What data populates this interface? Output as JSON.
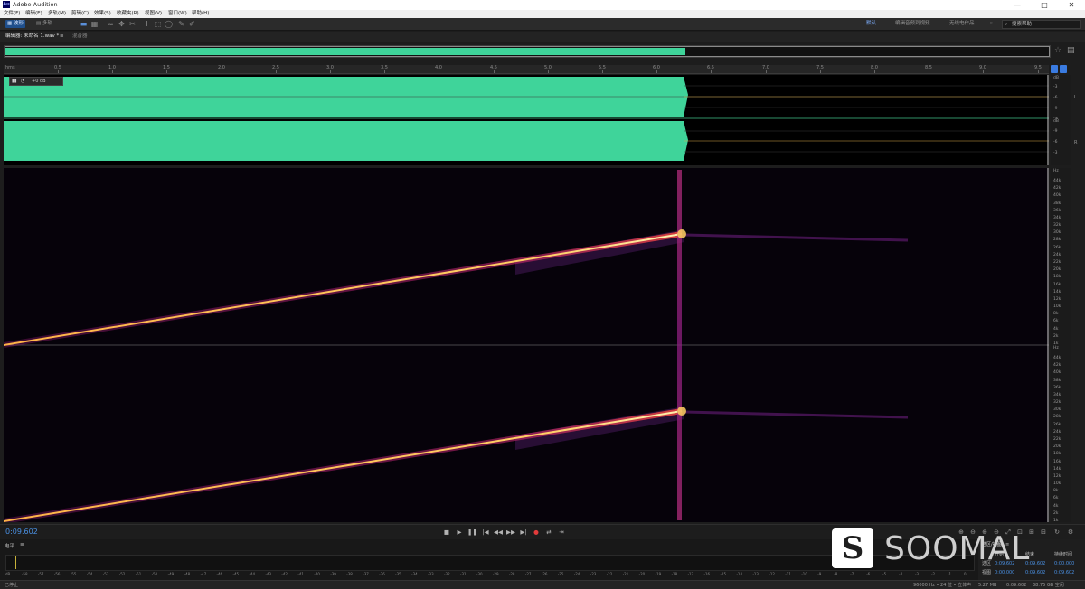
{
  "app": {
    "title": "Adobe Audition",
    "icon_text": "Au"
  },
  "window_controls": {
    "minimize": "—",
    "maximize": "□",
    "close": "✕"
  },
  "menu": [
    "文件(F)",
    "编辑(E)",
    "多轨(M)",
    "剪辑(C)",
    "效果(S)",
    "收藏夹(R)",
    "视图(V)",
    "窗口(W)",
    "帮助(H)"
  ],
  "toolbar": {
    "mode_waveform": "波形",
    "mode_multitrack": "多轨",
    "workspace_default": "默认",
    "workspace_edit_audio_video": "编辑音频到视频",
    "workspace_radio": "无线电作品",
    "overflow": "»",
    "search_placeholder": "搜索帮助"
  },
  "tabs": {
    "editor": "编辑器: 未命名 1.wav *",
    "editor_menu": "≡",
    "mixer": "混音器"
  },
  "ruler": {
    "unit": "hms",
    "labels": [
      "0.5",
      "1.0",
      "1.5",
      "2.0",
      "2.5",
      "3.0",
      "3.5",
      "4.0",
      "4.5",
      "5.0",
      "5.5",
      "6.0",
      "6.5",
      "7.0",
      "7.5",
      "8.0",
      "8.5",
      "9.0",
      "9.5"
    ]
  },
  "hud": {
    "volume": "+0 dB"
  },
  "waveform_scale": {
    "unit": "dB",
    "labels": [
      "-3",
      "-6",
      "-9",
      "-∞",
      "-9",
      "-6",
      "-3"
    ],
    "channel_labels": [
      "L",
      "R"
    ]
  },
  "spectral_scale": {
    "unit": "Hz",
    "labels": [
      "44k",
      "42k",
      "40k",
      "38k",
      "36k",
      "34k",
      "32k",
      "30k",
      "28k",
      "26k",
      "24k",
      "22k",
      "20k",
      "18k",
      "16k",
      "14k",
      "12k",
      "10k",
      "8k",
      "6k",
      "4k",
      "2k",
      "1k"
    ]
  },
  "transport": {
    "current_time": "0:09.602",
    "buttons": [
      "■",
      "▶",
      "❚❚",
      "|◀",
      "◀◀",
      "▶▶",
      "▶|",
      "●",
      "⇄",
      "⇥"
    ]
  },
  "levels": {
    "header": "电平",
    "menu": "≡",
    "scale": [
      "dB",
      "-58",
      "-57",
      "-56",
      "-55",
      "-54",
      "-53",
      "-52",
      "-51",
      "-50",
      "-49",
      "-48",
      "-47",
      "-46",
      "-45",
      "-44",
      "-43",
      "-42",
      "-41",
      "-40",
      "-39",
      "-38",
      "-37",
      "-36",
      "-35",
      "-34",
      "-33",
      "-32",
      "-31",
      "-30",
      "-29",
      "-28",
      "-27",
      "-26",
      "-25",
      "-24",
      "-23",
      "-22",
      "-21",
      "-20",
      "-19",
      "-18",
      "-17",
      "-16",
      "-15",
      "-14",
      "-13",
      "-12",
      "-11",
      "-10",
      "-9",
      "-8",
      "-7",
      "-6",
      "-5",
      "-4",
      "-3",
      "-2",
      "-1",
      "0"
    ]
  },
  "selection_view": {
    "title": "选区/视图",
    "menu": "≡",
    "col_start": "开始",
    "col_end": "结束",
    "col_duration": "持续时间",
    "row_selection": "选区",
    "row_view": "视图",
    "sel_start": "0:09.602",
    "sel_end": "0:09.602",
    "sel_duration": "0:00.000",
    "view_start": "0:00.000",
    "view_end": "0:09.602",
    "view_duration": "0:09.602"
  },
  "status": {
    "left": "已停止",
    "sample_info": "96000 Hz • 24 位 • 立体声",
    "file_size": "5.27 MB",
    "duration": "0:09.602",
    "free_space": "38.75 GB 空闲"
  },
  "watermark": {
    "mark": "S",
    "text": "SOOMAL"
  },
  "colors": {
    "waveform": "#3fd49a",
    "accent": "#4a90e2",
    "spectrum_hot": "#ffd060",
    "record": "#e23b3b"
  }
}
